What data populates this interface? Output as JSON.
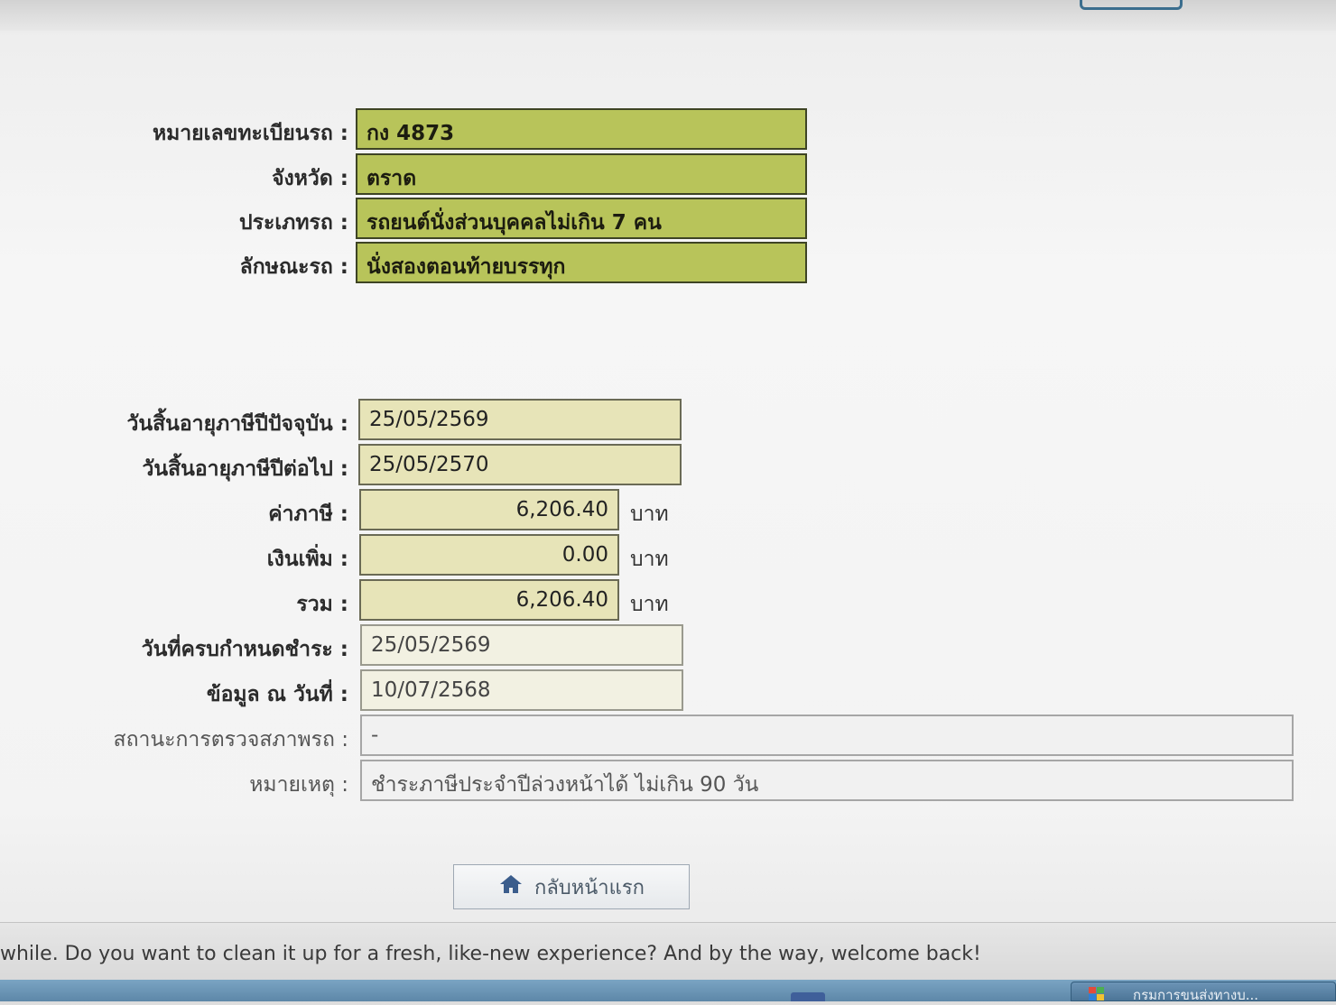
{
  "vehicle": {
    "plate_label": "หมายเลขทะเบียนรถ :",
    "plate_value": "กง 4873",
    "province_label": "จังหวัด :",
    "province_value": "ตราด",
    "type_label": "ประเภทรถ :",
    "type_value": "รถยนต์นั่งส่วนบุคคลไม่เกิน 7 คน",
    "style_label": "ลักษณะรถ :",
    "style_value": "นั่งสองตอนท้ายบรรทุก"
  },
  "tax": {
    "current_expiry_label": "วันสิ้นอายุภาษีปีปัจจุบัน :",
    "current_expiry_value": "25/05/2569",
    "next_expiry_label": "วันสิ้นอายุภาษีปีต่อไป :",
    "next_expiry_value": "25/05/2570",
    "fee_label": "ค่าภาษี :",
    "fee_value": "6,206.40",
    "surcharge_label": "เงินเพิ่ม :",
    "surcharge_value": "0.00",
    "total_label": "รวม :",
    "total_value": "6,206.40",
    "unit": "บาท",
    "due_label": "วันที่ครบกำหนดชำระ :",
    "due_value": "25/05/2569",
    "asof_label": "ข้อมูล ณ วันที่ :",
    "asof_value": "10/07/2568",
    "inspection_label": "สถานะการตรวจสภาพรถ :",
    "inspection_value": "-",
    "remark_label": "หมายเหตุ :",
    "remark_value": "ชำระภาษีประจำปีล่วงหน้าได้ ไม่เกิน 90 วัน"
  },
  "home_button": {
    "label": "กลับหน้าแรก",
    "icon": "home-icon"
  },
  "notification": {
    "text": "while. Do you want to clean it up for a fresh, like-new experience? And by the way, welcome back!"
  },
  "taskbar": {
    "task_label": "กรมการขนส่งทางบ..."
  },
  "colors": {
    "olive": "#b8c45a",
    "khaki": "#e7e4b8",
    "pale": "#f2f1e2",
    "accent_blue": "#3b6e8e"
  }
}
